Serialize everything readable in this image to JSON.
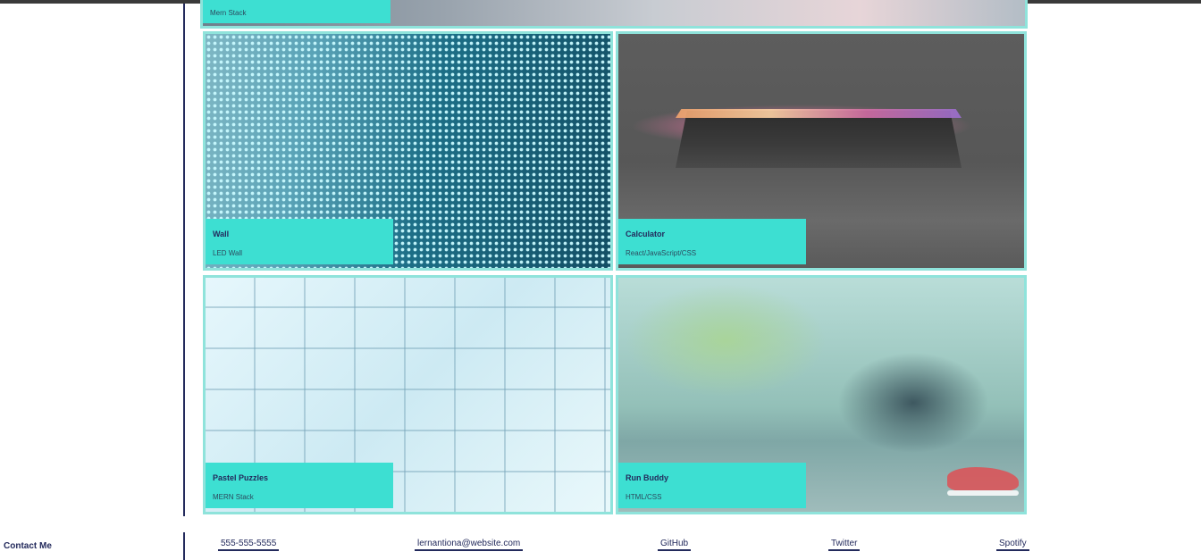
{
  "projects": [
    {
      "title": "",
      "subtitle": "Mern Stack"
    },
    {
      "title": "Wall",
      "subtitle": "LED Wall"
    },
    {
      "title": "Calculator",
      "subtitle": "React/JavaScript/CSS"
    },
    {
      "title": "Pastel Puzzles",
      "subtitle": "MERN Stack"
    },
    {
      "title": "Run Buddy",
      "subtitle": "HTML/CSS"
    }
  ],
  "footer": {
    "heading": "Contact Me",
    "links": [
      {
        "label": "555-555-5555"
      },
      {
        "label": "lernantiona@website.com"
      },
      {
        "label": "GitHub"
      },
      {
        "label": "Twitter"
      },
      {
        "label": "Spotify"
      }
    ]
  },
  "colors": {
    "accent": "#3ddfd2",
    "card_border": "#8fe3db",
    "navy": "#232a5c"
  },
  "icons": []
}
